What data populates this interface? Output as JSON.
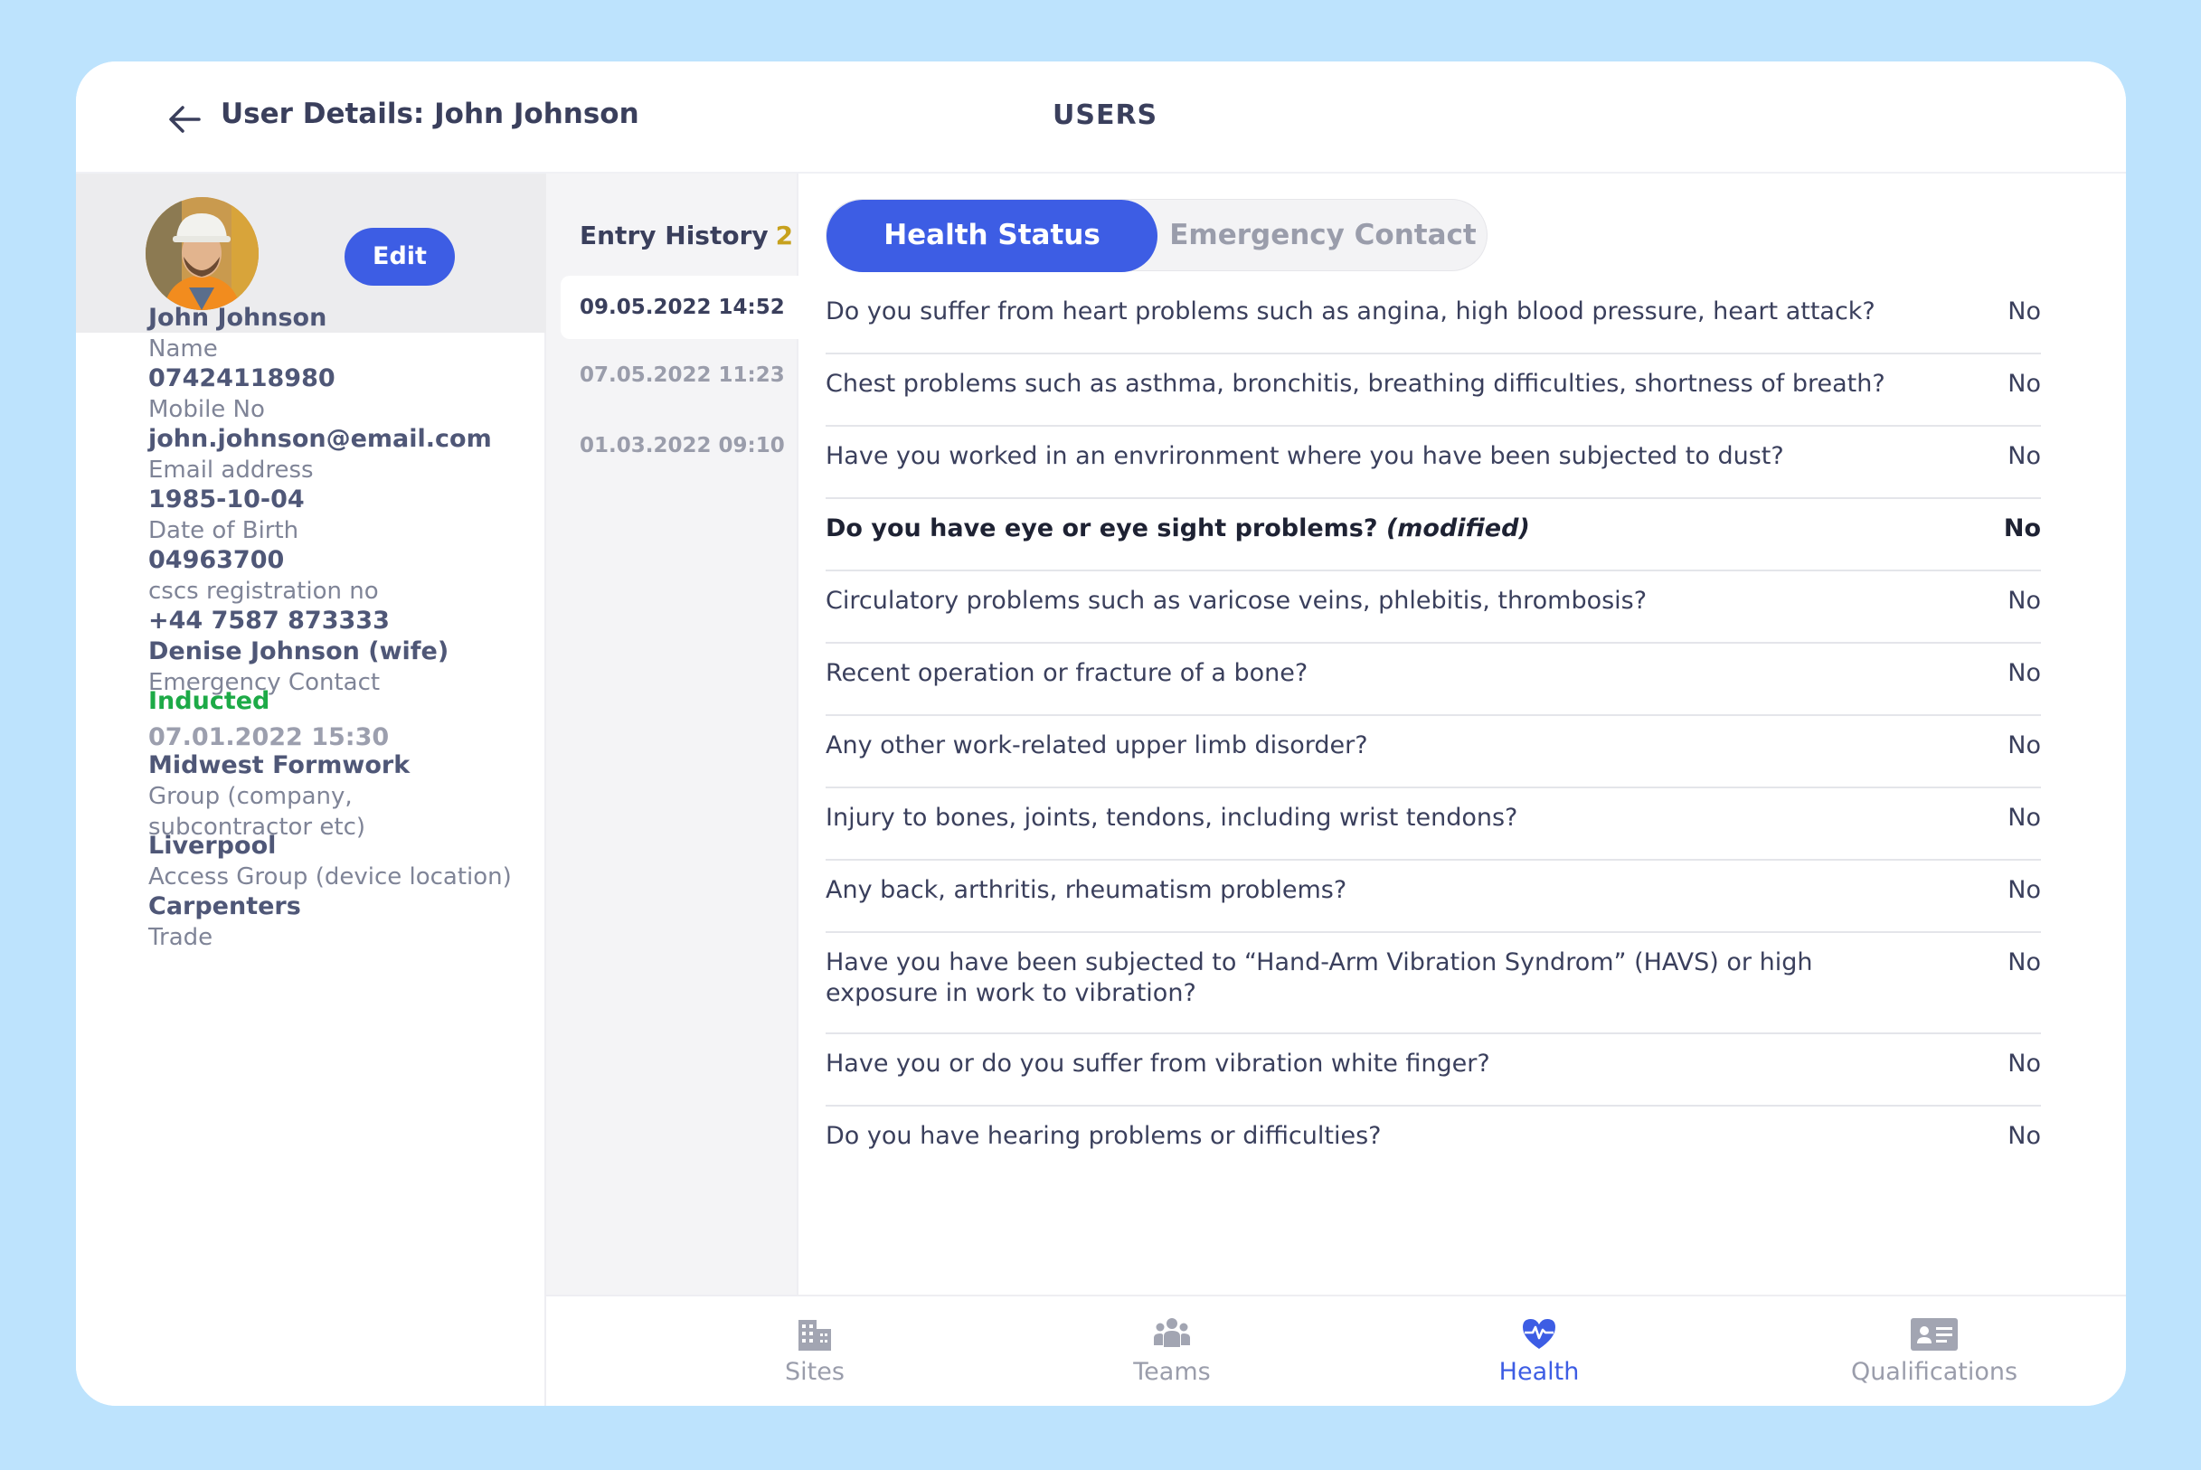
{
  "header": {
    "title": "User Details: John Johnson",
    "section": "USERS"
  },
  "profile": {
    "edit_label": "Edit",
    "fields": [
      {
        "value": "John Johnson",
        "label": "Name"
      },
      {
        "value": "07424118980",
        "label": "Mobile No"
      },
      {
        "value": "john.johnson@email.com",
        "label": "Email address"
      },
      {
        "value": "1985-10-04",
        "label": "Date of Birth"
      },
      {
        "value": "04963700",
        "label": "cscs registration no"
      }
    ],
    "emergency": {
      "phone": "+44 7587 873333",
      "name": "Denise Johnson (wife)",
      "label": "Emergency Contact"
    },
    "induction": {
      "status": "Inducted",
      "date": "07.01.2022  15:30"
    },
    "group": {
      "value": "Midwest Formwork",
      "label_line1": "Group (company,",
      "label_line2": "subcontractor etc)"
    },
    "access_group": {
      "value": "Liverpool",
      "label": "Access Group (device location)"
    },
    "trade": {
      "value": "Carpenters",
      "label": "Trade"
    }
  },
  "history": {
    "title": "Entry History",
    "count": "2",
    "entries": [
      "09.05.2022 14:52",
      "07.05.2022 11:23",
      "01.03.2022 09:10"
    ]
  },
  "tabs": {
    "health_status": "Health Status",
    "emergency_contact": "Emergency Contact"
  },
  "questions": [
    {
      "text": "Do you suffer from heart problems such as angina, high blood pressure, heart attack?",
      "answer": "No"
    },
    {
      "text": "Chest problems such as asthma, bronchitis, breathing difficulties, shortness of breath?",
      "answer": "No"
    },
    {
      "text": "Have you worked in an envrironment where you have been subjected to dust?",
      "answer": "No"
    },
    {
      "text": "Do you have eye or eye sight problems?",
      "modified": "(modified)",
      "answer": "No"
    },
    {
      "text": "Circulatory problems such as varicose veins, phlebitis, thrombosis?",
      "answer": "No"
    },
    {
      "text": "Recent operation or fracture of a bone?",
      "answer": "No"
    },
    {
      "text": "Any other work-related upper limb disorder?",
      "answer": "No"
    },
    {
      "text": "Injury to bones, joints, tendons, including wrist tendons?",
      "answer": "No"
    },
    {
      "text": "Any back, arthritis, rheumatism problems?",
      "answer": "No"
    },
    {
      "text_line1": "Have you have been subjected to “Hand-Arm Vibration Syndrom” (HAVS) or high",
      "text_line2": "exposure in work to vibration?",
      "answer": "No"
    },
    {
      "text": "Have you or do you suffer from vibration white finger?",
      "answer": "No"
    },
    {
      "text": "Do you have hearing problems or difficulties?",
      "answer": "No"
    }
  ],
  "nav": {
    "sites": "Sites",
    "teams": "Teams",
    "health": "Health",
    "qualifications": "Qualifications"
  },
  "colors": {
    "background": "#BDE3FD",
    "accent": "#3D5DE4",
    "inducted": "#1DAA47",
    "count": "#C7A11D"
  }
}
